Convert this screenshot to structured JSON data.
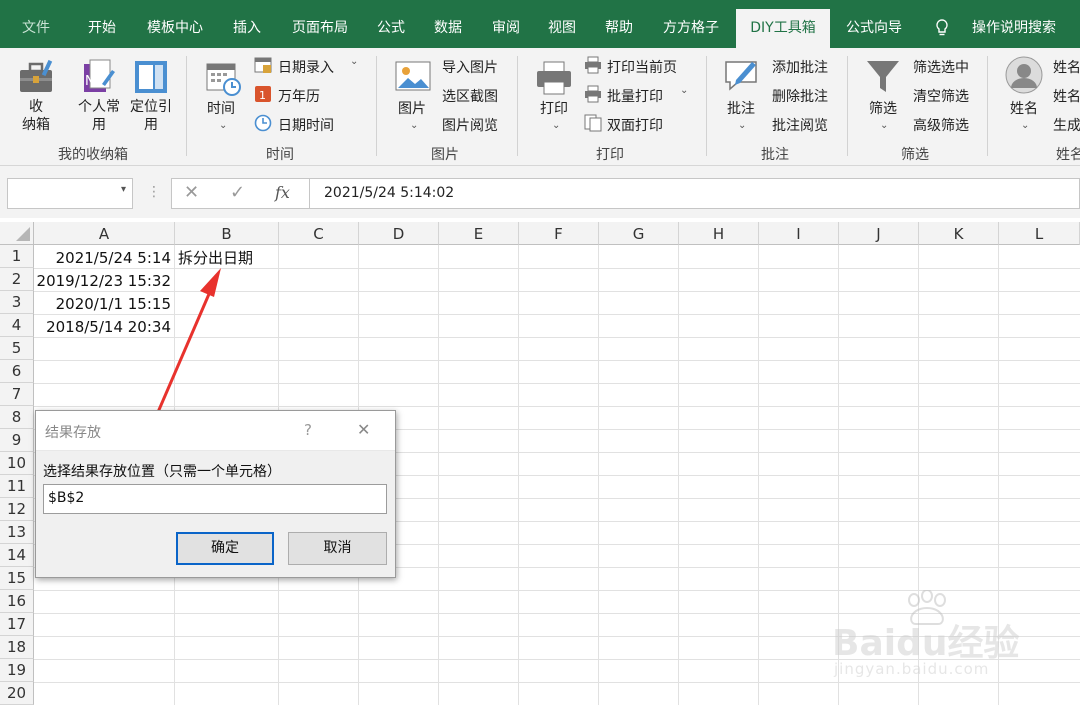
{
  "tabs": [
    {
      "label": "文件"
    },
    {
      "label": "开始"
    },
    {
      "label": "模板中心"
    },
    {
      "label": "插入"
    },
    {
      "label": "页面布局"
    },
    {
      "label": "公式"
    },
    {
      "label": "数据"
    },
    {
      "label": "审阅"
    },
    {
      "label": "视图"
    },
    {
      "label": "帮助"
    },
    {
      "label": "方方格子"
    },
    {
      "label": "DIY工具箱"
    },
    {
      "label": "公式向导"
    },
    {
      "label": "操作说明搜索"
    }
  ],
  "ribbon": {
    "collection": {
      "big": [
        "收\n纳箱",
        "个人常\n用",
        "定位引\n用"
      ],
      "group": "我的收纳箱"
    },
    "time": {
      "big": "时间",
      "items": [
        "日期录入",
        "万年历",
        "日期时间"
      ],
      "group": "时间"
    },
    "picture": {
      "big": "图片",
      "items": [
        "导入图片",
        "选区截图",
        "图片阅览"
      ],
      "group": "图片"
    },
    "print": {
      "big": "打印",
      "items": [
        "打印当前页",
        "批量打印",
        "双面打印"
      ],
      "group": "打印"
    },
    "comment": {
      "big": "批注",
      "items": [
        "添加批注",
        "删除批注",
        "批注阅览"
      ],
      "group": "批注"
    },
    "filter": {
      "big": "筛选",
      "items": [
        "筛选选中",
        "清空筛选",
        "高级筛选"
      ],
      "group": "筛选"
    },
    "name": {
      "big": "姓名",
      "items": [
        "姓名",
        "姓名",
        "生成"
      ],
      "group": "姓名"
    }
  },
  "formula_bar": {
    "name_box": "",
    "fx": "fx",
    "value": "2021/5/24  5:14:02"
  },
  "columns": [
    "A",
    "B",
    "C",
    "D",
    "E",
    "F",
    "G",
    "H",
    "I",
    "J",
    "K",
    "L"
  ],
  "rows": [
    "1",
    "2",
    "3",
    "4",
    "5",
    "6",
    "7",
    "8",
    "9",
    "10",
    "11",
    "12",
    "13",
    "14",
    "15",
    "16",
    "17",
    "18",
    "19",
    "20"
  ],
  "cells": {
    "A1": "2021/5/24 5:14",
    "B1": "拆分出日期",
    "A2": "2019/12/23 15:32",
    "A3": "2020/1/1 15:15",
    "A4": "2018/5/14 20:34"
  },
  "dialog": {
    "title": "结果存放",
    "help": "?",
    "close": "✕",
    "prompt": "选择结果存放位置（只需一个单元格）",
    "input_value": "$B$2",
    "ok": "确定",
    "cancel": "取消"
  },
  "watermark": {
    "brand": "Baidu经验",
    "url": "jingyan.baidu.com"
  },
  "colors": {
    "ribbon_green": "#217346",
    "annotation_red": "#e8322d",
    "primary_button_border": "#0a64c8"
  }
}
